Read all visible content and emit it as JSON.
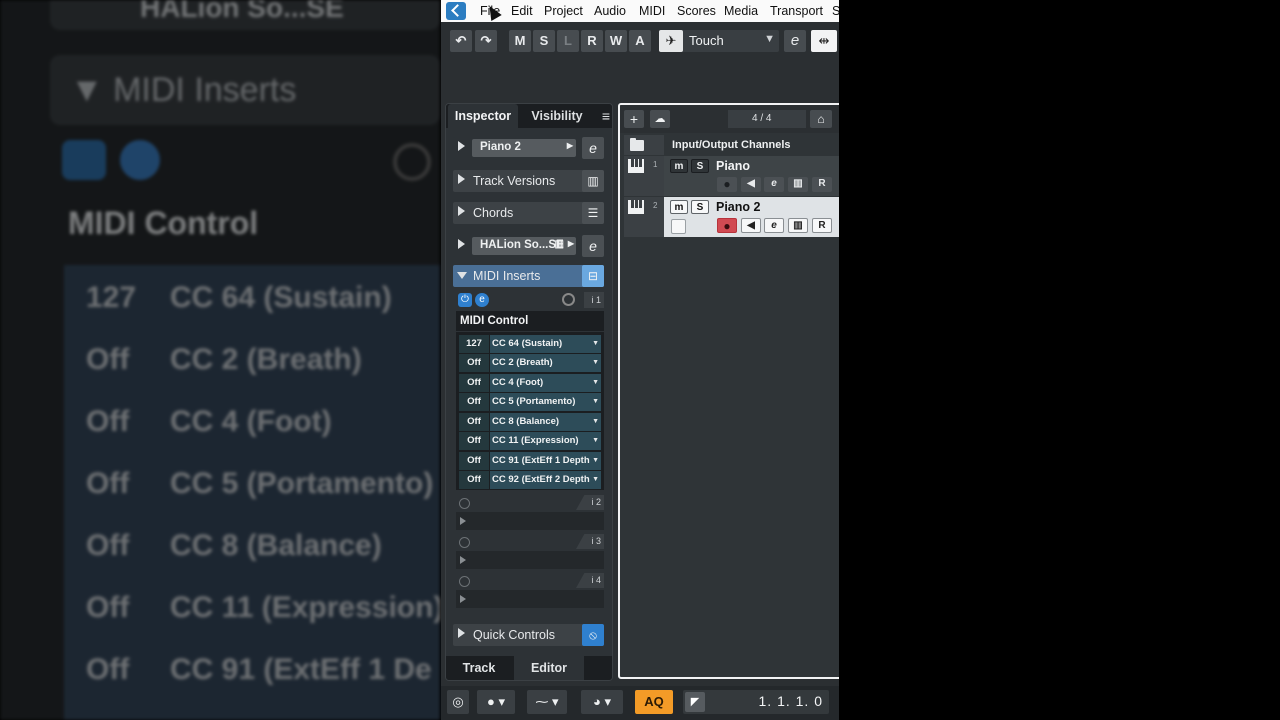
{
  "background": {
    "top_label": "HALion So...SE",
    "header": "▼ MIDI Inserts",
    "title": "MIDI Control",
    "rows": [
      {
        "value": "127",
        "name": "CC 64  (Sustain)"
      },
      {
        "value": "Off",
        "name": "CC 2  (Breath)"
      },
      {
        "value": "Off",
        "name": "CC 4  (Foot)"
      },
      {
        "value": "Off",
        "name": "CC 5  (Portamento)"
      },
      {
        "value": "Off",
        "name": "CC 8  (Balance)"
      },
      {
        "value": "Off",
        "name": "CC 11  (Expression)"
      },
      {
        "value": "Off",
        "name": "CC 91  (ExtEff 1 De"
      }
    ]
  },
  "menubar": {
    "items": [
      "File",
      "Edit",
      "Project",
      "Audio",
      "MIDI",
      "Scores",
      "Media",
      "Transport",
      "S"
    ]
  },
  "toolbar": {
    "undo_icon": "undo-icon",
    "redo_icon": "redo-icon",
    "m": "M",
    "s": "S",
    "l": "L",
    "r": "R",
    "w": "W",
    "a": "A",
    "automation_mode": "Touch",
    "edit_label": "e"
  },
  "inspector": {
    "tabs": [
      "Inspector",
      "Visibility"
    ],
    "menu_icon": "≡",
    "track_name": "Piano 2",
    "sections": {
      "track_versions": "Track Versions",
      "chords": "Chords",
      "instrument": "HALion So...SE",
      "midi_inserts": "MIDI Inserts",
      "quick_controls": "Quick Controls"
    },
    "insert_slot_1": "i 1",
    "midi_control": {
      "title": "MIDI Control",
      "rows": [
        {
          "value": "127",
          "name": "CC 64  (Sustain)"
        },
        {
          "value": "Off",
          "name": "CC 2  (Breath)"
        },
        {
          "value": "Off",
          "name": "CC 4  (Foot)"
        },
        {
          "value": "Off",
          "name": "CC 5  (Portamento)"
        },
        {
          "value": "Off",
          "name": "CC 8  (Balance)"
        },
        {
          "value": "Off",
          "name": "CC 11  (Expression)"
        },
        {
          "value": "Off",
          "name": "CC 91  (ExtEff 1 Depth"
        },
        {
          "value": "Off",
          "name": "CC 92  (ExtEff 2 Depth"
        }
      ]
    },
    "empty_slots": [
      "i 2",
      "i 3",
      "i 4"
    ],
    "bottom_tabs": [
      "Track",
      "Editor"
    ]
  },
  "project": {
    "track_count": "4 / 4",
    "folder_label": "Input/Output Channels",
    "tracks": [
      {
        "number": "1",
        "name": "Piano",
        "selected": false
      },
      {
        "number": "2",
        "name": "Piano 2",
        "selected": true
      }
    ],
    "btn_m": "m",
    "btn_s": "S",
    "btn_r": "R",
    "btn_e": "e"
  },
  "transport": {
    "aq": "AQ",
    "position": "1. 1. 1.   0"
  },
  "colors": {
    "accent_blue": "#2c7dc1",
    "record_red": "#d14a52",
    "aq_orange": "#f39b27"
  }
}
